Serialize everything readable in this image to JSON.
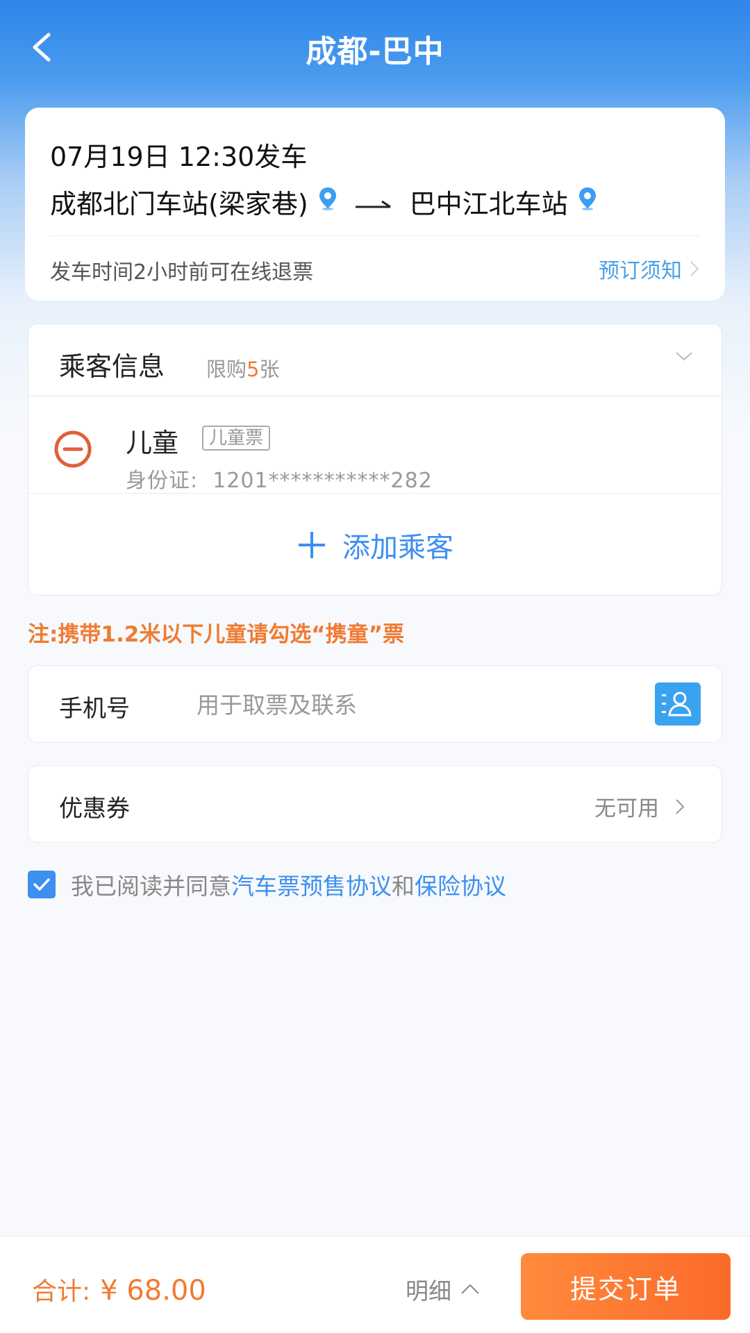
{
  "header": {
    "title": "成都-巴中"
  },
  "trip": {
    "datetime": "07月19日   12:30发车",
    "origin": "成都北门车站(梁家巷)",
    "destination": "巴中江北车站",
    "refund_note": "发车时间2小时前可在线退票",
    "notice_link": "预订须知"
  },
  "passenger_section": {
    "title": "乘客信息",
    "limit_prefix": "限购",
    "limit_count": "5",
    "limit_suffix": "张",
    "passengers": [
      {
        "name": "儿童",
        "ticket_type": "儿童票",
        "id_label": "身份证:",
        "id_number": "1201***********282"
      }
    ],
    "add_label": "添加乘客"
  },
  "child_note": "注:携带1.2米以下儿童请勾选“携童”票",
  "phone": {
    "label": "手机号",
    "value": "",
    "placeholder": "用于取票及联系"
  },
  "coupon": {
    "label": "优惠券",
    "value": "无可用"
  },
  "agreement": {
    "prefix": "我已阅读并同意",
    "link1": "汽车票预售协议",
    "conj": "和",
    "link2": "保险协议",
    "checked": true
  },
  "footer": {
    "total_label": "合计:",
    "total_amount": "¥ 68.00",
    "detail_label": "明细",
    "submit_label": "提交订单"
  },
  "colors": {
    "primary_blue": "#3d8ff0",
    "accent_orange": "#f07b32",
    "submit_gradient_start": "#ff8a3c",
    "submit_gradient_end": "#fb6a2a"
  },
  "icons": [
    "back-arrow-icon",
    "location-pin-icon",
    "arrow-right-long-icon",
    "chevron-right-icon",
    "chevron-down-icon",
    "minus-circle-icon",
    "plus-icon",
    "contact-book-icon",
    "checkmark-icon",
    "chevron-up-icon"
  ]
}
